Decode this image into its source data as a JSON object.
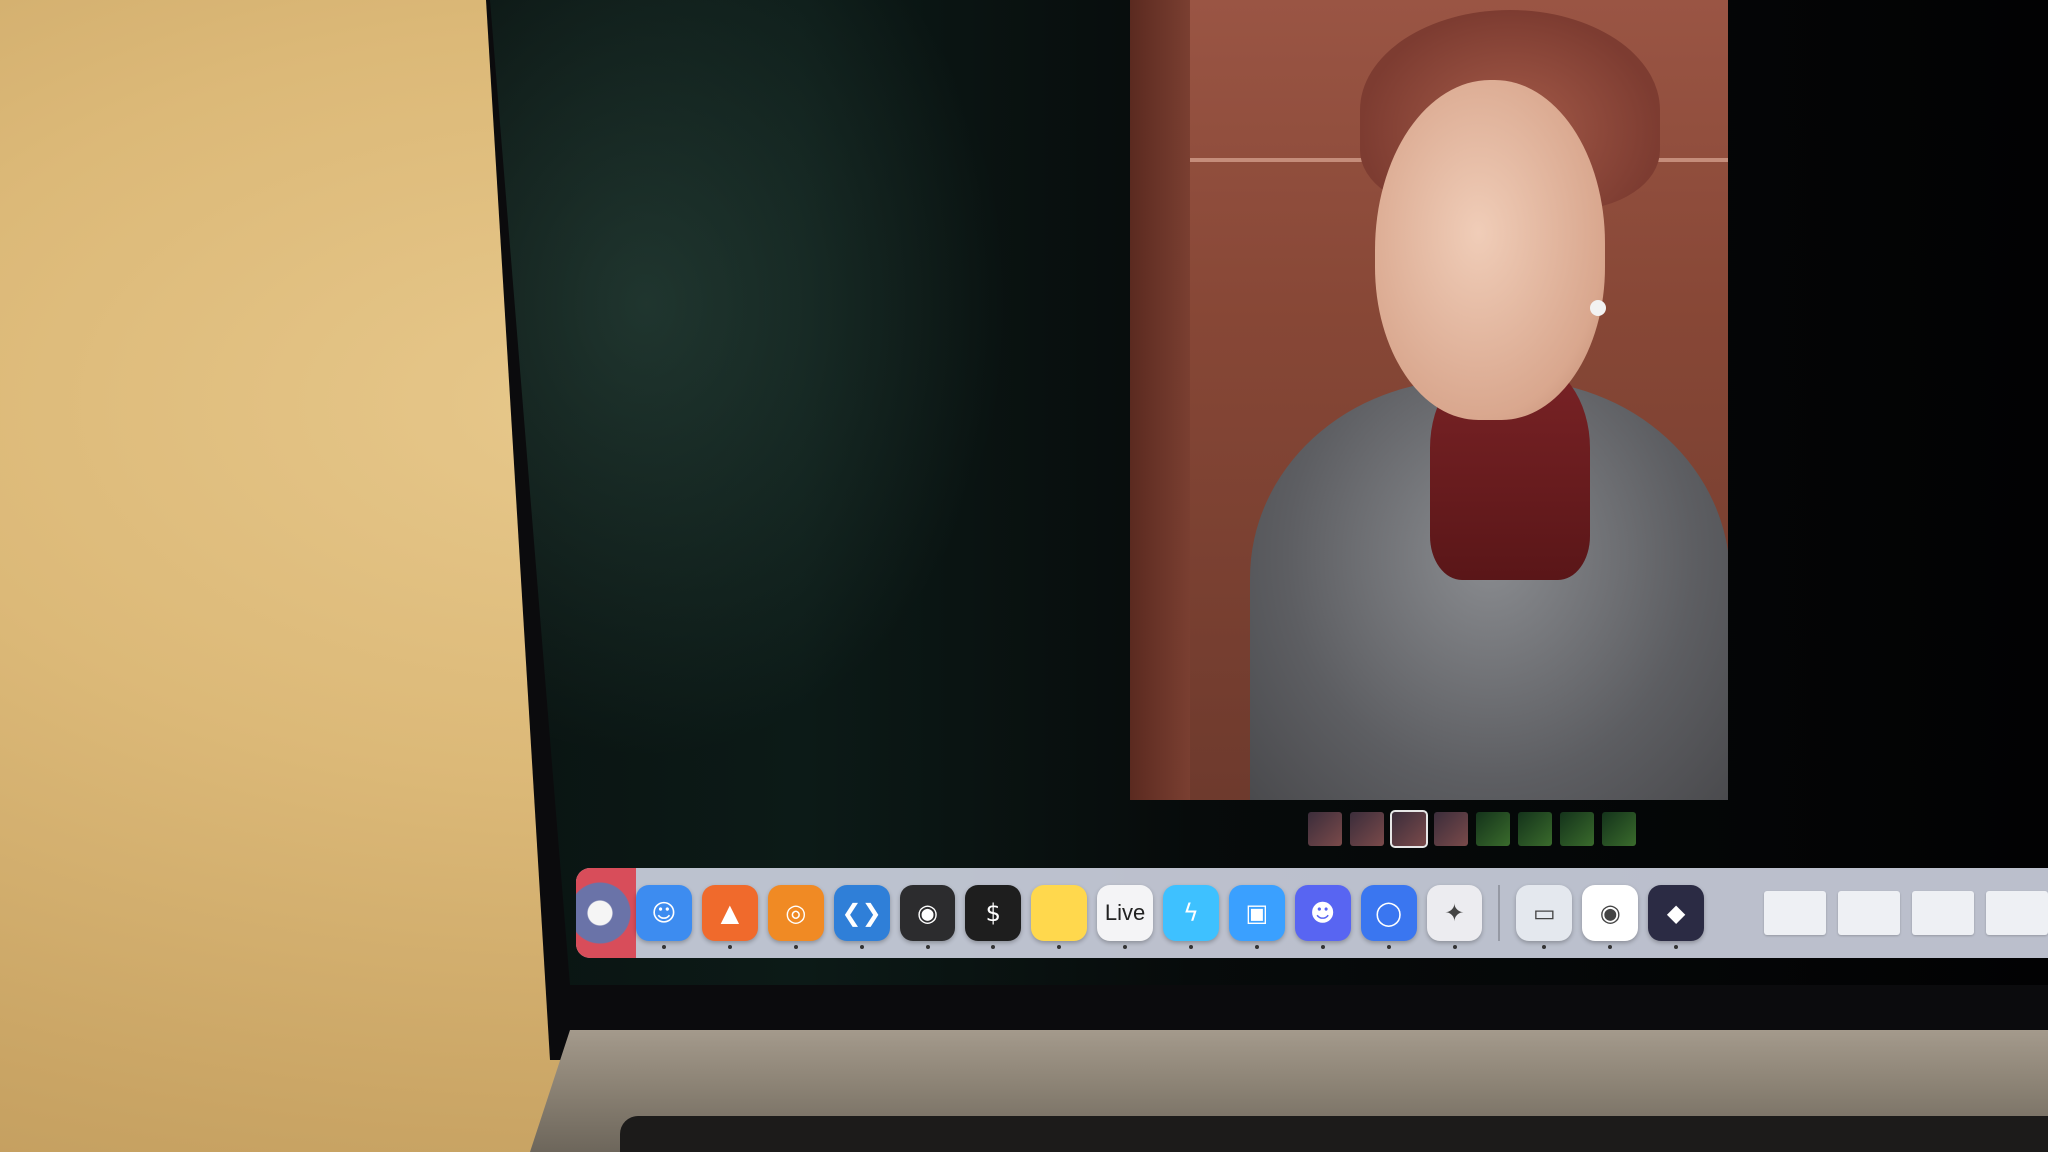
{
  "dock": {
    "apps": [
      {
        "icon": "finder-icon",
        "color": "#3d8cf0",
        "glyph": "☺"
      },
      {
        "icon": "brave-browser-icon",
        "color": "#f06a2c",
        "glyph": "▲"
      },
      {
        "icon": "blender-icon",
        "color": "#f08a24",
        "glyph": "◎"
      },
      {
        "icon": "vscode-icon",
        "color": "#2f7fd8",
        "glyph": "❮❯"
      },
      {
        "icon": "obs-icon",
        "color": "#2c2c2e",
        "glyph": "◉"
      },
      {
        "icon": "terminal-icon",
        "color": "#1e1e1e",
        "glyph": "$"
      },
      {
        "icon": "notes-icon",
        "color": "#ffd84d",
        "glyph": ""
      },
      {
        "icon": "live-app-icon",
        "color": "#f4f4f6",
        "glyph": "Live"
      },
      {
        "icon": "reeder-icon",
        "color": "#3ec1ff",
        "glyph": "ϟ"
      },
      {
        "icon": "screen-share-icon",
        "color": "#3aa0ff",
        "glyph": "▣"
      },
      {
        "icon": "discord-icon",
        "color": "#5865f2",
        "glyph": "☻"
      },
      {
        "icon": "signal-icon",
        "color": "#3a76f0",
        "glyph": "◯"
      },
      {
        "icon": "star-app-icon",
        "color": "#ececf0",
        "glyph": "✦"
      },
      {
        "icon": "preview-icon",
        "color": "#e4e8ee",
        "glyph": "▭"
      },
      {
        "icon": "chrome-icon",
        "color": "#ffffff",
        "glyph": "◉"
      },
      {
        "icon": "obsidian-icon",
        "color": "#2b2b44",
        "glyph": "◆"
      }
    ],
    "live_label": "Live",
    "minimized_count": 4
  },
  "photo_viewer": {
    "thumbnails": [
      {
        "kind": "portrait"
      },
      {
        "kind": "portrait"
      },
      {
        "kind": "selected"
      },
      {
        "kind": "portrait"
      },
      {
        "kind": "green"
      },
      {
        "kind": "green"
      },
      {
        "kind": "green"
      },
      {
        "kind": "green"
      }
    ]
  }
}
